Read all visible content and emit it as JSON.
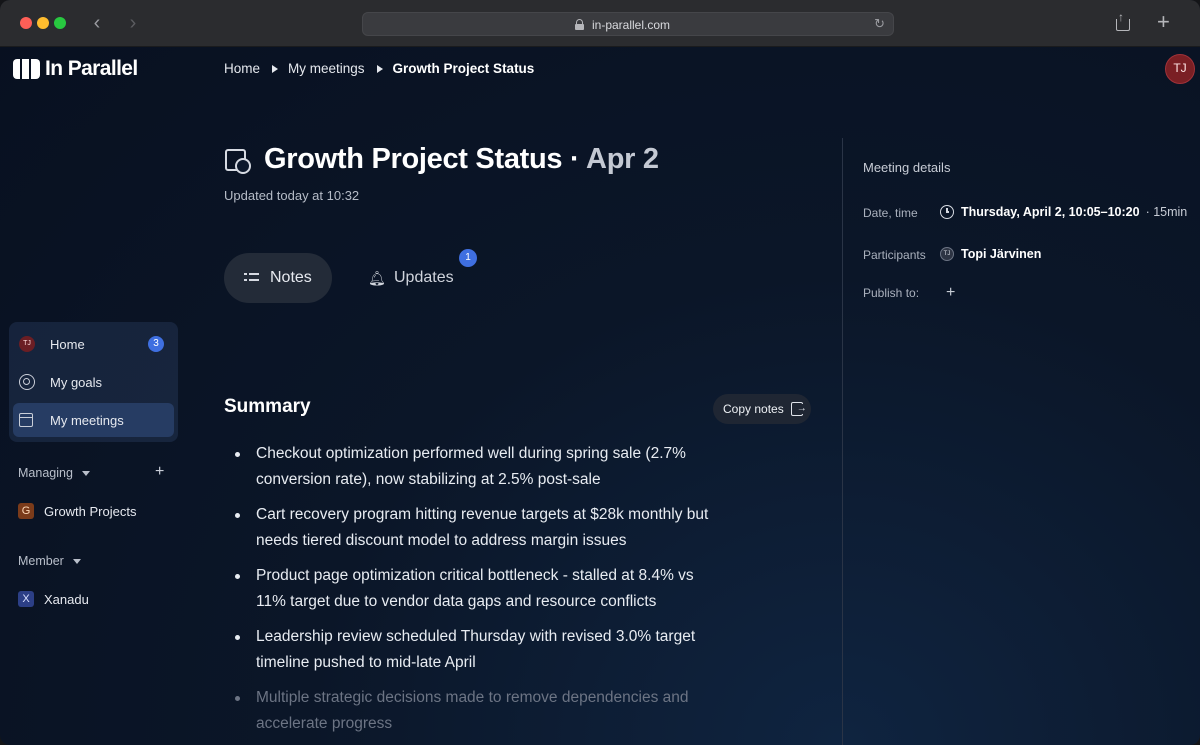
{
  "browser": {
    "url": "in-parallel.com",
    "back_icon": "‹",
    "forward_icon": "›",
    "reload_icon": "↻",
    "new_tab_icon": "+"
  },
  "app": {
    "logo_text": "In Parallel",
    "user_initials": "TJ"
  },
  "breadcrumb": {
    "items": [
      "Home",
      "My meetings"
    ],
    "current": "Growth Project Status"
  },
  "sidebar": {
    "items": [
      {
        "label": "Home",
        "avatar": "TJ",
        "badge": "3"
      },
      {
        "label": "My goals"
      },
      {
        "label": "My meetings"
      }
    ],
    "managing_label": "Managing",
    "managing_add": "+",
    "managing_teams": [
      {
        "initial": "G",
        "label": "Growth Projects"
      }
    ],
    "member_label": "Member",
    "member_teams": [
      {
        "initial": "X",
        "label": "Xanadu"
      }
    ]
  },
  "meeting": {
    "title": "Growth Project Status",
    "separator": " · ",
    "date": "Apr 2",
    "updated": "Updated today at 10:32"
  },
  "tabs": {
    "notes": "Notes",
    "updates": "Updates",
    "updates_badge": "1"
  },
  "summary": {
    "title": "Summary",
    "copy_label": "Copy notes",
    "bullets": [
      "Checkout optimization performed well during spring sale (2.7% conversion rate), now stabilizing at 2.5% post-sale",
      "Cart recovery program hitting revenue targets at $28k monthly but needs tiered discount model to address margin issues",
      "Product page optimization critical bottleneck - stalled at 8.4% vs 11% target due to vendor data gaps and resource conflicts",
      "Leadership review scheduled Thursday with revised 3.0% target timeline pushed to mid-late April",
      "Multiple strategic decisions made to remove dependencies and accelerate progress"
    ]
  },
  "details": {
    "title": "Meeting details",
    "date_label": "Date, time",
    "date_value": "Thursday, April 2, 10:05–10:20",
    "duration": "· 15min",
    "participants_label": "Participants",
    "participant_initials": "TJ",
    "participant_name": "Topi Järvinen",
    "publish_label": "Publish to:",
    "publish_add": "+"
  },
  "colors": {
    "accent_blue": "#3f6fe0",
    "avatar_red": "#7a1f24",
    "background": "#0b1628"
  }
}
